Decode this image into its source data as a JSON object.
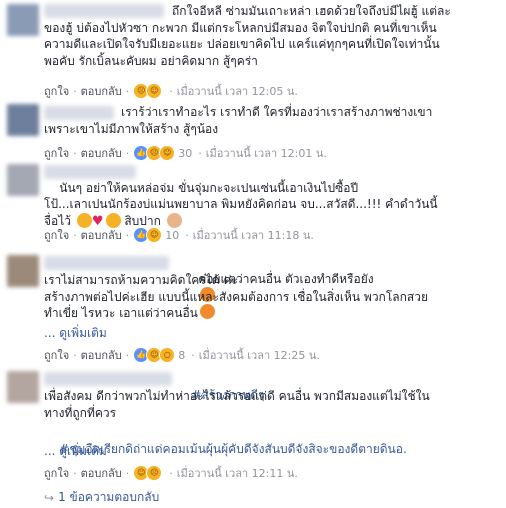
{
  "comments": [
    {
      "text": "ถึกใจอีหลี ซ่ามมันเถาะหล่า เฮดด้วยใจถึงบ่มีไผฮู้ แต่ละ\nของฮู้ บ่ต้องไปหัวซา กะพวก มีแต่กระโหลกบ่มีสมอง จิตใจบ่ปกติ คนที่เขาเห็น\nความดีและเปิดใจรับมีเยอะแยะ ปล่อยเขาคิดไป แคร์แค่ทุกๆคนที่เปิดใจเท่านั้น\nพอคับ รักเบิ้ลนะคับผม อย่าคิดมาก สู้ๆคร่า",
      "like": "ถูกใจ",
      "reply": "ตอบกลับ",
      "count": "",
      "time": "เมื่อวานนี้ เวลา 12:05 น.",
      "reactions": [
        "sad-icon",
        "haha-icon"
      ]
    },
    {
      "text": "เราร้ว่าเราทำอะไร เราทำดี ใครที่มองว่าเราสร้างภาพช่างเขา\nเพราะเขาไม่มีภาพให้สร้าง สู้ๆน้อง",
      "like": "ถูกใจ",
      "reply": "ตอบกลับ",
      "count": "30",
      "time": "เมื่อวานนี้ เวลา 12:01 น.",
      "reactions": [
        "like-icon",
        "sad-icon",
        "haha-icon"
      ]
    },
    {
      "text": "นันๆ อย่าให้คนหล่อจ่ม ขั่นจุ่มกะจะเปนเซ่นนี้เอาเงินไปซื้อปี\nโป้...เลาเปนนักร้องบ่แม่นพยาบาล พิมหยังคิดก่อน จบ...สวัสดี...!!! คำดำวันนี้\nจื่อไว้",
      "text_tail": "สิบปาก",
      "like": "ถูกใจ",
      "reply": "ตอบกลับ",
      "count": "10",
      "time": "เมื่อวานนี้ เวลา 11:18 น.",
      "reactions": [
        "like-icon",
        "haha-icon"
      ]
    },
    {
      "text": "ค่อยแตว่าคนอื่น ตัวเองทำดีหรือยัง",
      "text2": "เราไม่สามารถห้ามความคิดใครได้ ค่ะ\nสร้างภาพต่อไปค่ะเฮีย แบบนี้แหละสังคมต้องการ เชื่อในสิ่งเห็น พวกโลกสวย\nทำเขี่ย ไรหวะ เอาแต่ว่าคนอื่น",
      "see_more": "ดูเพิ่มเติม",
      "like": "ถูกใจ",
      "reply": "ตอบกลับ",
      "count": "8",
      "time": "เมื่อวานนี้ เวลา 12:25 น.",
      "reactions": [
        "like-icon",
        "haha-icon",
        "wow-icon"
      ]
    },
    {
      "hashtag": "#สร้างภาพดีๆ",
      "text": "เพื่อสังคม ดีกว่าพวกไม่ทำห่าอะไรแล้วรอแต่ดี คนอื่น พวกมีสมองแต่ไม่ใช้ใน\nทางที่ถูกที่ควร",
      "hashtag2": "#ชุมอืดเรียกดิถ่าแด่คอมเม้นผุ้นผุ้คับดีจังสันบดีจังสิจะของดีตายดินอ.",
      "see_more": "ดูเพิ่มเติม",
      "like": "ถูกใจ",
      "reply": "ตอบกลับ",
      "count": "",
      "time": "เมื่อวานนี้ เวลา 12:11 น.",
      "reactions": [
        "haha-icon",
        "sad-icon"
      ]
    }
  ],
  "reply_summary": "1 ข้อความตอบกลับ",
  "colors": {
    "link": "#365899",
    "meta": "#90949c",
    "text": "#1d2129"
  }
}
